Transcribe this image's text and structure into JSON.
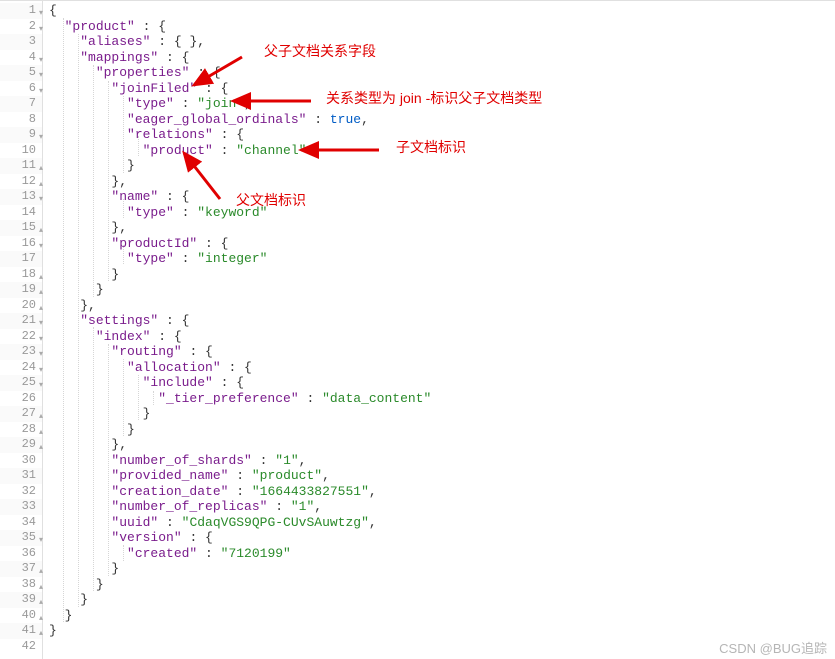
{
  "watermark": "CSDN @BUG追踪",
  "annotations": {
    "a1": "父子文档关系字段",
    "a2": "关系类型为 join -标识父子文档类型",
    "a3": "子文档标识",
    "a4": "父文档标识"
  },
  "gutter": [
    {
      "n": "1",
      "f": "▾"
    },
    {
      "n": "2",
      "f": "▾"
    },
    {
      "n": "3",
      "f": ""
    },
    {
      "n": "4",
      "f": "▾"
    },
    {
      "n": "5",
      "f": "▾"
    },
    {
      "n": "6",
      "f": "▾"
    },
    {
      "n": "7",
      "f": ""
    },
    {
      "n": "8",
      "f": ""
    },
    {
      "n": "9",
      "f": "▾"
    },
    {
      "n": "10",
      "f": ""
    },
    {
      "n": "11",
      "f": "▴"
    },
    {
      "n": "12",
      "f": "▴"
    },
    {
      "n": "13",
      "f": "▾"
    },
    {
      "n": "14",
      "f": ""
    },
    {
      "n": "15",
      "f": "▴"
    },
    {
      "n": "16",
      "f": "▾"
    },
    {
      "n": "17",
      "f": ""
    },
    {
      "n": "18",
      "f": "▴"
    },
    {
      "n": "19",
      "f": "▴"
    },
    {
      "n": "20",
      "f": "▴"
    },
    {
      "n": "21",
      "f": "▾"
    },
    {
      "n": "22",
      "f": "▾"
    },
    {
      "n": "23",
      "f": "▾"
    },
    {
      "n": "24",
      "f": "▾"
    },
    {
      "n": "25",
      "f": "▾"
    },
    {
      "n": "26",
      "f": ""
    },
    {
      "n": "27",
      "f": "▴"
    },
    {
      "n": "28",
      "f": "▴"
    },
    {
      "n": "29",
      "f": "▴"
    },
    {
      "n": "30",
      "f": ""
    },
    {
      "n": "31",
      "f": ""
    },
    {
      "n": "32",
      "f": ""
    },
    {
      "n": "33",
      "f": ""
    },
    {
      "n": "34",
      "f": ""
    },
    {
      "n": "35",
      "f": "▾"
    },
    {
      "n": "36",
      "f": ""
    },
    {
      "n": "37",
      "f": "▴"
    },
    {
      "n": "38",
      "f": "▴"
    },
    {
      "n": "39",
      "f": "▴"
    },
    {
      "n": "40",
      "f": "▴"
    },
    {
      "n": "41",
      "f": "▴"
    },
    {
      "n": "42",
      "f": ""
    }
  ],
  "code": {
    "l1": "{",
    "l2k1": "\"product\"",
    "l2p": " : {",
    "l3k1": "\"aliases\"",
    "l3p": " : { },",
    "l4k1": "\"mappings\"",
    "l4p": " : {",
    "l5k1": "\"properties\"",
    "l5p": " : {",
    "l6k1": "\"joinFiled\"",
    "l6p": " : {",
    "l7k1": "\"type\"",
    "l7p": " : ",
    "l7s": "\"join\"",
    "l7e": ",",
    "l8k1": "\"eager_global_ordinals\"",
    "l8p": " : ",
    "l8b": "true",
    "l8e": ",",
    "l9k1": "\"relations\"",
    "l9p": " : {",
    "l10k1": "\"product\"",
    "l10p": " : ",
    "l10s": "\"channel\"",
    "l11": "}",
    "l12": "},",
    "l13k1": "\"name\"",
    "l13p": " : {",
    "l14k1": "\"type\"",
    "l14p": " : ",
    "l14s": "\"keyword\"",
    "l15": "},",
    "l16k1": "\"productId\"",
    "l16p": " : {",
    "l17k1": "\"type\"",
    "l17p": " : ",
    "l17s": "\"integer\"",
    "l18": "}",
    "l19": "}",
    "l20": "},",
    "l21k1": "\"settings\"",
    "l21p": " : {",
    "l22k1": "\"index\"",
    "l22p": " : {",
    "l23k1": "\"routing\"",
    "l23p": " : {",
    "l24k1": "\"allocation\"",
    "l24p": " : {",
    "l25k1": "\"include\"",
    "l25p": " : {",
    "l26k1": "\"_tier_preference\"",
    "l26p": " : ",
    "l26s": "\"data_content\"",
    "l27": "}",
    "l28": "}",
    "l29": "},",
    "l30k1": "\"number_of_shards\"",
    "l30p": " : ",
    "l30s": "\"1\"",
    "l30e": ",",
    "l31k1": "\"provided_name\"",
    "l31p": " : ",
    "l31s": "\"product\"",
    "l31e": ",",
    "l32k1": "\"creation_date\"",
    "l32p": " : ",
    "l32s": "\"1664433827551\"",
    "l32e": ",",
    "l33k1": "\"number_of_replicas\"",
    "l33p": " : ",
    "l33s": "\"1\"",
    "l33e": ",",
    "l34k1": "\"uuid\"",
    "l34p": " : ",
    "l34s": "\"CdaqVGS9QPG-CUvSAuwtzg\"",
    "l34e": ",",
    "l35k1": "\"version\"",
    "l35p": " : {",
    "l36k1": "\"created\"",
    "l36p": " : ",
    "l36s": "\"7120199\"",
    "l37": "}",
    "l38": "}",
    "l39": "}",
    "l40": "}",
    "l41": "}",
    "l42": ""
  }
}
